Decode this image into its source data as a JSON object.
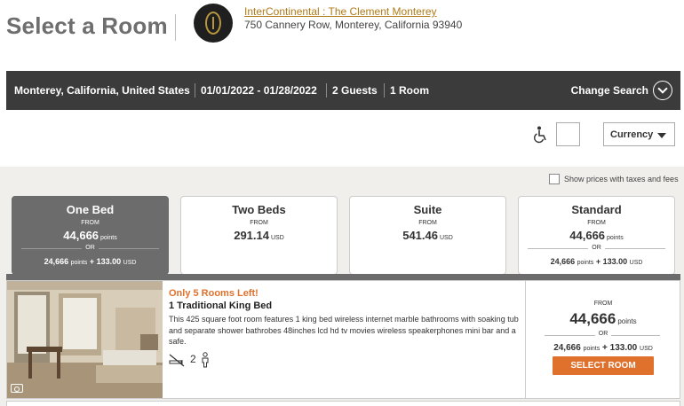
{
  "header": {
    "title": "Select a Room",
    "hotel_name": "InterContinental : The Clement Monterey",
    "hotel_address": "750 Cannery Row, Monterey, California 93940",
    "logo_icon": "intercontinental-logo"
  },
  "search": {
    "location": "Monterey, California, United States",
    "dates": "01/01/2022 - 01/28/2022",
    "guests": "2 Guests",
    "rooms": "1 Room",
    "change_label": "Change Search"
  },
  "tools": {
    "accessibility_icon": "wheelchair-icon",
    "currency_label": "Currency"
  },
  "tax_toggle_label": "Show prices with taxes and fees",
  "tabs": [
    {
      "name": "One Bed",
      "from": "FROM",
      "price": "44,666",
      "unit": "points",
      "or": "OR",
      "combo_points": "24,666",
      "combo_points_unit": "points",
      "combo_cash": "+ 133.00",
      "combo_cash_unit": "USD",
      "active": true
    },
    {
      "name": "Two Beds",
      "from": "FROM",
      "price": "291.14",
      "unit": "USD",
      "active": false
    },
    {
      "name": "Suite",
      "from": "FROM",
      "price": "541.46",
      "unit": "USD",
      "active": false
    },
    {
      "name": "Standard",
      "from": "FROM",
      "price": "44,666",
      "unit": "points",
      "or": "OR",
      "combo_points": "24,666",
      "combo_points_unit": "points",
      "combo_cash": "+ 133.00",
      "combo_cash_unit": "USD",
      "active": false
    }
  ],
  "room": {
    "availability": "Only 5 Rooms Left!",
    "title": "1 Traditional King Bed",
    "description": "This 425 square foot room features 1 king bed wireless internet marble bathrooms with soaking tub and separate shower bathrobes 48inches lcd hd tv movies wireless speakerphones mini bar and a safe.",
    "guests": "2",
    "from": "FROM",
    "price": "44,666",
    "price_unit": "points",
    "or": "OR",
    "combo_points": "24,666",
    "combo_points_unit": "points",
    "combo_cash": "+ 133.00",
    "combo_cash_unit": "USD",
    "select_label": "SELECT ROOM"
  },
  "colors": {
    "accent_orange": "#e0712c",
    "hotel_link": "#b07a18",
    "search_bar_bg": "#3b3b3b",
    "active_tab_bg": "#6c6c6c"
  }
}
